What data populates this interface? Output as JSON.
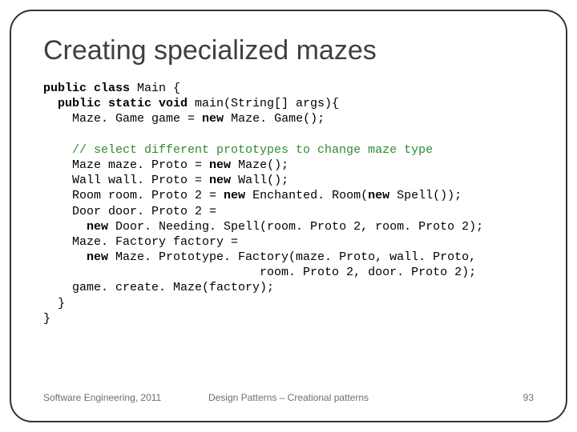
{
  "title": "Creating specialized mazes",
  "code": {
    "l1a": "public class",
    "l1b": " Main {",
    "l2a": "  public static void",
    "l2b": " main(String[] args){",
    "l3a": "    Maze. Game game = ",
    "l3b": "new",
    "l3c": " Maze. Game();",
    "l4": "",
    "l5": "    // select different prototypes to change maze type",
    "l6a": "    Maze maze. Proto = ",
    "l6b": "new",
    "l6c": " Maze();",
    "l7a": "    Wall wall. Proto = ",
    "l7b": "new",
    "l7c": " Wall();",
    "l8a": "    Room room. Proto 2 = ",
    "l8b": "new",
    "l8c": " Enchanted. Room(",
    "l8d": "new",
    "l8e": " Spell());",
    "l9": "    Door door. Proto 2 =",
    "l10a": "      new",
    "l10b": " Door. Needing. Spell(room. Proto 2, room. Proto 2);",
    "l11": "    Maze. Factory factory =",
    "l12a": "      new",
    "l12b": " Maze. Prototype. Factory(maze. Proto, wall. Proto,",
    "l13": "                              room. Proto 2, door. Proto 2);",
    "l14": "    game. create. Maze(factory);",
    "l15": "  }",
    "l16": "}"
  },
  "footer": {
    "left": "Software Engineering, 2011",
    "center": "Design Patterns – Creational patterns",
    "right": "93"
  }
}
